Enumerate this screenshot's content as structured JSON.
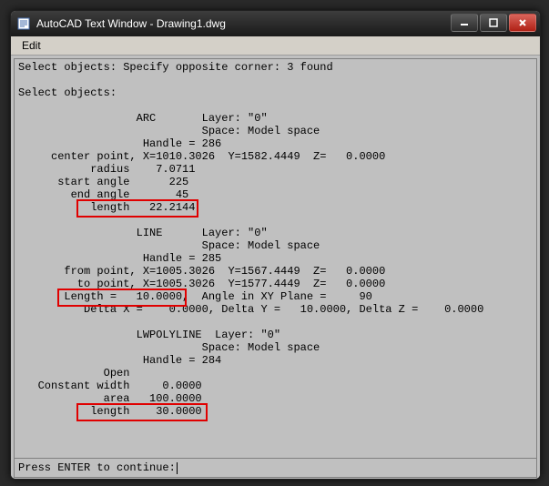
{
  "window": {
    "title": "AutoCAD Text Window - Drawing1.dwg"
  },
  "menu": {
    "edit": "Edit"
  },
  "lines": {
    "l0": "Select objects: Specify opposite corner: 3 found",
    "l1": "",
    "l2": "Select objects:",
    "l3": "",
    "l4": "                  ARC       Layer: \"0\"",
    "l5": "                            Space: Model space",
    "l6": "                   Handle = 286",
    "l7": "     center point, X=1010.3026  Y=1582.4449  Z=   0.0000",
    "l8": "           radius    7.0711",
    "l9": "      start angle      225",
    "l10": "        end angle       45",
    "l11": "           length   22.2144",
    "l12": "",
    "l13": "                  LINE      Layer: \"0\"",
    "l14": "                            Space: Model space",
    "l15": "                   Handle = 285",
    "l16": "       from point, X=1005.3026  Y=1567.4449  Z=   0.0000",
    "l17": "         to point, X=1005.3026  Y=1577.4449  Z=   0.0000",
    "l18": "       Length =   10.0000,  Angle in XY Plane =     90",
    "l19": "          Delta X =    0.0000, Delta Y =   10.0000, Delta Z =    0.0000",
    "l20": "",
    "l21": "                  LWPOLYLINE  Layer: \"0\"",
    "l22": "                            Space: Model space",
    "l23": "                   Handle = 284",
    "l24": "             Open",
    "l25": "   Constant width     0.0000",
    "l26": "             area   100.0000",
    "l27": "           length    30.0000"
  },
  "prompt": {
    "label": "Press ENTER to continue: ",
    "value": ""
  },
  "chart_data": {
    "type": "table",
    "title": "AutoCAD LIST command output (3 entities)",
    "entities": [
      {
        "type": "ARC",
        "layer": "0",
        "space": "Model space",
        "handle": "286",
        "center": {
          "x": 1010.3026,
          "y": 1582.4449,
          "z": 0.0
        },
        "radius": 7.0711,
        "start_angle": 225,
        "end_angle": 45,
        "length": 22.2144
      },
      {
        "type": "LINE",
        "layer": "0",
        "space": "Model space",
        "handle": "285",
        "from": {
          "x": 1005.3026,
          "y": 1567.4449,
          "z": 0.0
        },
        "to": {
          "x": 1005.3026,
          "y": 1577.4449,
          "z": 0.0
        },
        "length": 10.0,
        "angle_xy_plane": 90,
        "delta": {
          "x": 0.0,
          "y": 10.0,
          "z": 0.0
        }
      },
      {
        "type": "LWPOLYLINE",
        "layer": "0",
        "space": "Model space",
        "handle": "284",
        "open": true,
        "constant_width": 0.0,
        "area": 100.0,
        "length": 30.0
      }
    ],
    "highlighted": [
      {
        "entity_handle": "286",
        "field": "length",
        "value": 22.2144
      },
      {
        "entity_handle": "285",
        "field": "length",
        "value": 10.0
      },
      {
        "entity_handle": "284",
        "field": "length",
        "value": 30.0
      }
    ]
  }
}
